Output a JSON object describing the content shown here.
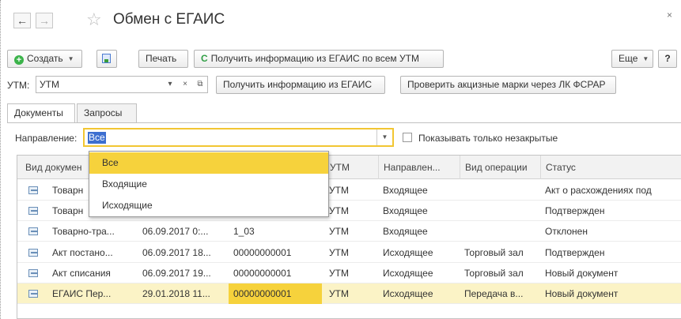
{
  "window": {
    "title": "Обмен с ЕГАИС",
    "close_label": "×"
  },
  "toolbar": {
    "create_label": "Создать",
    "print_label": "Печать",
    "fetch_all_label": "Получить информацию из ЕГАИС по всем УТМ",
    "more_label": "Еще",
    "help_label": "?"
  },
  "utm": {
    "label": "УТМ:",
    "value": "УТМ",
    "fetch_label": "Получить информацию из ЕГАИС",
    "check_label": "Проверить акцизные марки через ЛК ФСРАР"
  },
  "tabs": [
    {
      "label": "Документы",
      "active": true
    },
    {
      "label": "Запросы",
      "active": false
    }
  ],
  "filter": {
    "direction_label": "Направление:",
    "direction_value": "Все",
    "only_open_label": "Показывать только незакрытые"
  },
  "dropdown": {
    "options": [
      "Все",
      "Входящие",
      "Исходящие"
    ],
    "selected": "Все"
  },
  "table": {
    "headers": [
      "Вид докумен",
      "",
      "",
      "УТМ",
      "Направлен...",
      "Вид операции",
      "Статус"
    ],
    "rows": [
      {
        "doc": "Товарн",
        "date": "",
        "number": "",
        "utm": "УТМ",
        "direction": "Входящее",
        "operation": "",
        "status": "Акт о расхождениях под"
      },
      {
        "doc": "Товарн",
        "date": "",
        "number": "",
        "utm": "УТМ",
        "direction": "Входящее",
        "operation": "",
        "status": "Подтвержден"
      },
      {
        "doc": "Товарно-тра...",
        "date": "06.09.2017 0:...",
        "number": "1_03",
        "utm": "УТМ",
        "direction": "Входящее",
        "operation": "",
        "status": "Отклонен"
      },
      {
        "doc": "Акт постано...",
        "date": "06.09.2017 18...",
        "number": "00000000001",
        "utm": "УТМ",
        "direction": "Исходящее",
        "operation": "Торговый зал",
        "status": "Подтвержден"
      },
      {
        "doc": "Акт списания",
        "date": "06.09.2017 19...",
        "number": "00000000001",
        "utm": "УТМ",
        "direction": "Исходящее",
        "operation": "Торговый зал",
        "status": "Новый документ"
      },
      {
        "doc": "ЕГАИС Пер...",
        "date": "29.01.2018 11...",
        "number": "00000000001",
        "utm": "УТМ",
        "direction": "Исходящее",
        "operation": "Передача в...",
        "status": "Новый документ"
      }
    ]
  },
  "colors": {
    "accent_yellow": "#f6d23c",
    "selected_row": "#fbf3c6",
    "selection_blue": "#3d6fd0",
    "green": "#3bb34a"
  }
}
